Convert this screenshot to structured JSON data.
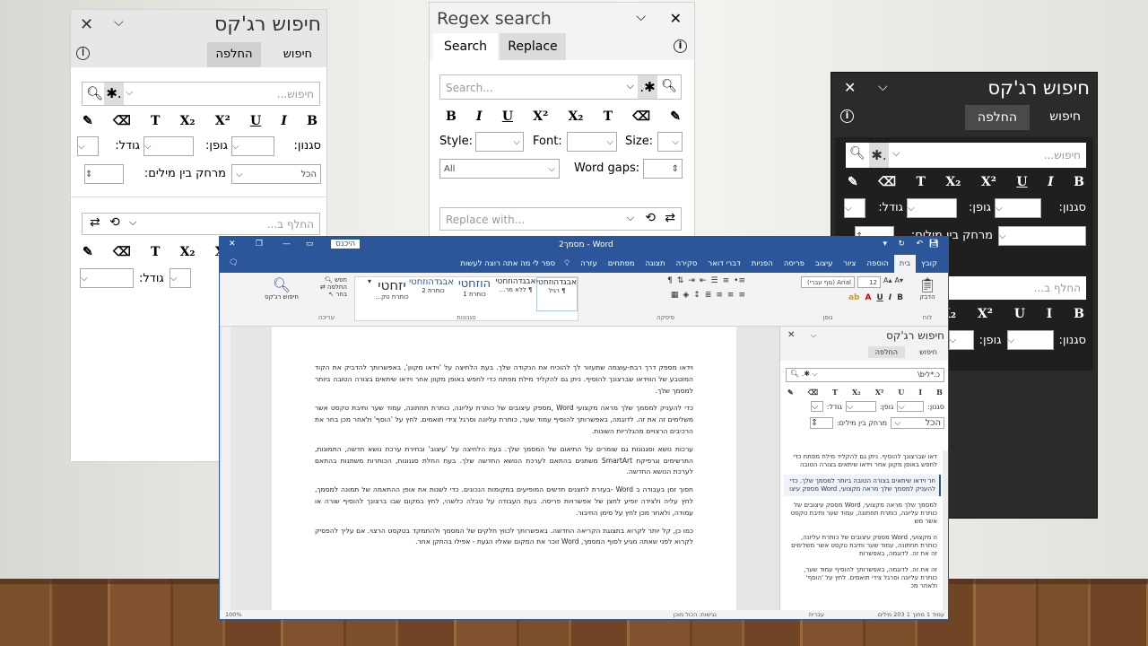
{
  "pane_he": {
    "title": "חיפוש רג'קס",
    "tabs": [
      "חיפוש",
      "החלפה"
    ],
    "search_placeholder": "חיפוש...",
    "fmt": [
      "B",
      "I",
      "U",
      "X2",
      "X2",
      "T"
    ],
    "style_label": "סגנון:",
    "font_label": "גופן:",
    "size_label": "גודל:",
    "gap_label": "מרחק בין מילים:",
    "all_value": "הכל",
    "replace_placeholder": "החלף ב..."
  },
  "pane_en": {
    "title": "Regex search",
    "tabs": [
      "Search",
      "Replace"
    ],
    "search_placeholder": "Search...",
    "fmt": [
      "B",
      "I",
      "U",
      "X2",
      "X2",
      "T"
    ],
    "style_label": "Style:",
    "font_label": "Font:",
    "size_label": "Size:",
    "all_value": "All",
    "gap_label": "Word gaps:",
    "replace_placeholder": "Replace with..."
  },
  "pane_dark": {
    "title": "חיפוש רג'קס",
    "tabs": [
      "חיפוש",
      "החלפה"
    ],
    "search_placeholder": "חיפוש...",
    "style_label": "סגנון:",
    "font_label": "גופן:",
    "size_label": "גודל:",
    "gap_label": "מרחק בין מילים:",
    "replace_placeholder": "החלף ב..."
  },
  "word": {
    "title": "מסמך2 - Word",
    "signin": "היכנס",
    "tell_me": "ספר לי מה אתה רוצה לעשות",
    "ribbon_tabs": [
      "קובץ",
      "בית",
      "הוספה",
      "ציור",
      "עיצוב",
      "פריסה",
      "הפניות",
      "דברי דואר",
      "סקירה",
      "תצוגה",
      "מפתחים",
      "עזרה"
    ],
    "font_name": "(גוף עברי) Arial",
    "font_size": "12",
    "styles": [
      {
        "preview": "אבגדהוזחטי",
        "name": "¶ רגיל"
      },
      {
        "preview": "אבגדהוזחטי",
        "name": "¶ ללא מר..."
      },
      {
        "preview": "הוזחטי",
        "name": "כותרת 1"
      },
      {
        "preview": "אבגדהוזחטי",
        "name": "כותרת 2"
      },
      {
        "preview": "יזחטי",
        "name": "כותרת טק..."
      }
    ],
    "editing": [
      "חפש",
      "החלפה",
      "בחר"
    ],
    "regex_btn": "חיפוש רג'קס",
    "groups": [
      "לוח",
      "גופן",
      "פיסקה",
      "סגנונות",
      "עריכה"
    ],
    "paste": "הדבק",
    "doc_paragraphs": [
      "וידאו מספק דרך רבת-עוצמה שתעזור לך להוכיח את הנקודה שלך. בעת הלחיצה על 'וידאו מקוון', באפשרותך להדביק את הקוד המוטבע של הווידאו שברצונך להוסיף. ניתן גם להקליד מילת מפתח כדי לחפש באופן מקוון אחר וידאו שיתאים בצורה הטובה ביותר למסמך שלך.",
      "כדי להעניק למסמך שלך מראה מקצועי Word ,מספק עיצובים של כותרת עליונה, כותרת תחתונה, עמוד שער ותיבת טקסט אשר משלימים זה את זה. לדוגמה, באפשרותך להוסיף עמוד שער, כותרת עליונה וסרגל צידי תואמים. לחץ על 'הוסף' ולאחר מכן בחר את הרכיבים הרצויים מהגלריות השונות.",
      "ערכות נושא וסגנונות גם שומרים על התיאום של המסמך שלך. בעת הלחיצה על 'עיצוב' ובחירת ערכת נושא חדשה, התמונות, התרשימים וגרפיקת SmartArt משתנים בהתאם לערכת הנושא החדשה שלך. בעת החלת סגנונות, הכותרות משתנות בהתאם לערכת הנושא החדשה.",
      "חסוך זמן בעבודה ב Word -בעזרת לחצנים חדשים המופיעים במקומות הנכונים. כדי לשנות את אופן ההתאמה של תמונה למסמך, לחץ עליה ולצידה יופיע לחצן של אפשרויות פריסה. בעת העבודה על טבלה כלשהי, לחץ במקום שבו ברצונך להוסיף שורה או עמודה, ולאחר מכן לחץ על סימן החיבור.",
      "כמו כן, קל יותר לקרוא בתצוגת הקריאה החדשה. באפשרותך לכווץ חלקים של המסמך ולהתמקד בטקסט הרצוי. אם עליך להפסיק לקרוא לפני שאתה מגיע לסוף המסמך, Word זוכר את המקום שאליו הגעת - אפילו בהתקן אחר."
    ],
    "side_pane": {
      "title": "חיפוש רג'קס",
      "tabs": [
        "חיפוש",
        "החלפה"
      ],
      "query": "\\bכ.*לי",
      "style_label": "סגנון:",
      "font_label": "גופן:",
      "size_label": "גודל:",
      "gap_label": "מרחק בין מילים:",
      "all_value": "הכל",
      "results": [
        "דאו שברצונך להוסיף. ניתן גם להקליד מילת מפתח כדי לחפש באופן מקוון אחר וידאו שיתאים בצורה הטובה",
        "חר וידאו שיתאים בצורה הטובה ביותר למסמך שלך. כדי להעניק למסמך שלך מראה מקצועי, Word מספק עיצו",
        "למסמך שלך מראה מקצועי, Word מספק עיצובים של כותרת עליונה, כותרת תחתונה, עמוד שער ותיבת טקסט אשר מש",
        "ה מקצועי, Word מספק עיצובים של כותרת עליונה, כותרת תחתונה, עמוד שער ותיבת טקסט אשר משלימים זה את זה. לדוגמה, באפשרות",
        "זה את זה. לדוגמה, באפשרותך להוסיף עמוד שער, כותרת עליונה וסרגל צידי תואמים. לחץ על 'הוסף' ולאחר מכ"
      ]
    },
    "status_left": "עמוד 1 מתוך 1   203 מילים",
    "status_lang": "עברית",
    "status_focus": "נגישות: הכול מוכן",
    "zoom": "100%"
  }
}
